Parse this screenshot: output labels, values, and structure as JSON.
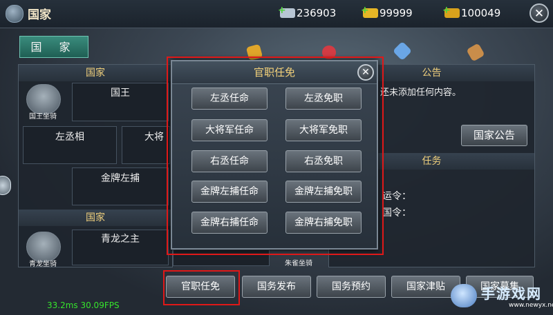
{
  "header": {
    "title": "国家",
    "resources": [
      {
        "icon": "silver-ingot-icon",
        "value": "236903",
        "color": "#b8c6d4"
      },
      {
        "icon": "gold-ingot-icon",
        "value": "99999",
        "color": "#e6b626"
      },
      {
        "icon": "gold-ticket-icon",
        "value": "100049",
        "color": "#d9a21c"
      }
    ]
  },
  "tabs": {
    "country": "国 家"
  },
  "left_panel": {
    "header1": "国家",
    "king": "国王",
    "king_mount": "国王坐骑",
    "left_chancellor": "左丞相",
    "general_partial": "大将",
    "gold_left_catcher": "金牌左捕",
    "header2": "国家",
    "qinglong_lord": "青龙之主",
    "qinglong_mount": "青龙坐骑",
    "zhuque_mount": "朱雀坐骑"
  },
  "right_panel": {
    "announcement_header": "公告",
    "announcement_text": "还未添加任何内容。",
    "announcement_button": "国家公告",
    "task_header": "任务",
    "order_1": "运令：",
    "order_2": "国令："
  },
  "dialog": {
    "title": "官职任免",
    "buttons": [
      [
        "左丞任命",
        "左丞免职"
      ],
      [
        "大将军任命",
        "大将军免职"
      ],
      [
        "右丞任命",
        "右丞免职"
      ],
      [
        "金牌左捕任命",
        "金牌左捕免职"
      ],
      [
        "金牌右捕任命",
        "金牌右捕免职"
      ]
    ]
  },
  "bottom_bar": {
    "appoint": "官职任免",
    "publish": "国务发布",
    "reserve": "国务预约",
    "subsidy": "国家津贴",
    "recruit": "国家募集"
  },
  "fps": "33.2ms 30.09FPS",
  "watermark": {
    "text": "手游戏网",
    "url": "www.newyx.net"
  }
}
